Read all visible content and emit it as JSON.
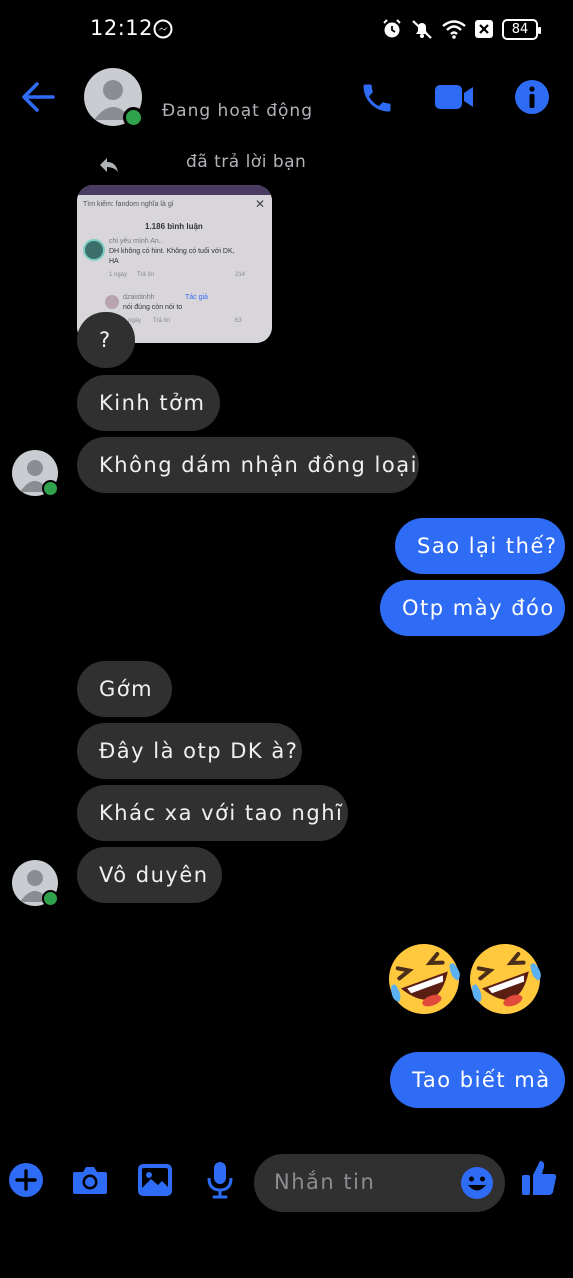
{
  "status_bar": {
    "time": "12:12",
    "battery": "84"
  },
  "header": {
    "status": "Đang hoạt động"
  },
  "reply": {
    "text": "đã trả lời bạn"
  },
  "shared_image": {
    "search": "Tìm kiếm: fandom nghĩa là gì",
    "comment_count": "1.186 bình luận",
    "c1_author": "chỉ yêu mình An..",
    "c1_text1": "DH không có hint. Không có tuổi với DK,",
    "c1_text2": "HA",
    "c1_meta_time": "1 ngày",
    "c1_meta_reply": "Trả lời",
    "c1_likes": "214",
    "c2_author": "dzaistinhh",
    "c2_badge": "Tác giả",
    "c2_text": "nói đúng còn nói to",
    "c2_meta_time": "1 ngày",
    "c2_meta_reply": "Trả lời",
    "c2_likes": "63"
  },
  "messages": {
    "m1": "?",
    "m2": "Kinh tởm",
    "m3": "Không dám nhận đồng loại",
    "m4": "Sao lại thế?",
    "m5": "Otp mày đóo",
    "m6": "Gớm",
    "m7": "Đây là otp DK à?",
    "m8": "Khác xa với tao nghĩ",
    "m9": "Vô duyên",
    "m10": "Tao biết mà"
  },
  "compose": {
    "placeholder": "Nhắn tin"
  },
  "colors": {
    "accent": "#2f6cf5",
    "incoming": "#303030",
    "online": "#31a24c"
  }
}
